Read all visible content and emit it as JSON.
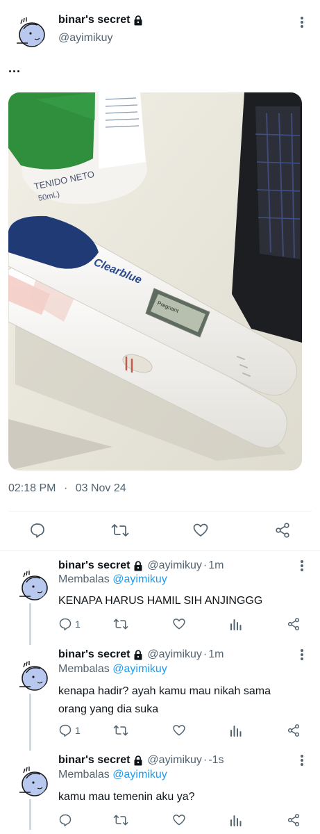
{
  "tweet": {
    "name": "binar's secret",
    "handle": "@ayimikuy",
    "text": "...",
    "timestamp": "02:18 PM",
    "date": "03 Nov 24",
    "photo_text": {
      "can_label": "TENIDO NETO",
      "can_sub": "50mL)",
      "brand": "Clearblue",
      "display": "Pregnant"
    }
  },
  "replies": [
    {
      "name": "binar's secret",
      "handle": "@ayimikuy",
      "time": "1m",
      "replying_label": "Membalas",
      "replying_to": "@ayimikuy",
      "text": "KENAPA HARUS HAMIL SIH ANJINGGG",
      "reply_count": "1"
    },
    {
      "name": "binar's secret",
      "handle": "@ayimikuy",
      "time": "1m",
      "replying_label": "Membalas",
      "replying_to": "@ayimikuy",
      "text": "kenapa hadir? ayah kamu mau nikah sama orang yang dia suka",
      "reply_count": "1"
    },
    {
      "name": "binar's secret",
      "handle": "@ayimikuy",
      "time": "-1s",
      "replying_label": "Membalas",
      "replying_to": "@ayimikuy",
      "text": "kamu mau temenin aku ya?",
      "reply_count": ""
    }
  ],
  "icons": {
    "lock": "lock-icon",
    "reply": "reply-icon",
    "retweet": "retweet-icon",
    "like": "heart-icon",
    "share": "share-icon",
    "views": "views-icon",
    "more": "more-icon"
  },
  "colors": {
    "text": "#0f1419",
    "secondary": "#536471",
    "link": "#1d9bf0",
    "divider": "#eff3f4"
  }
}
